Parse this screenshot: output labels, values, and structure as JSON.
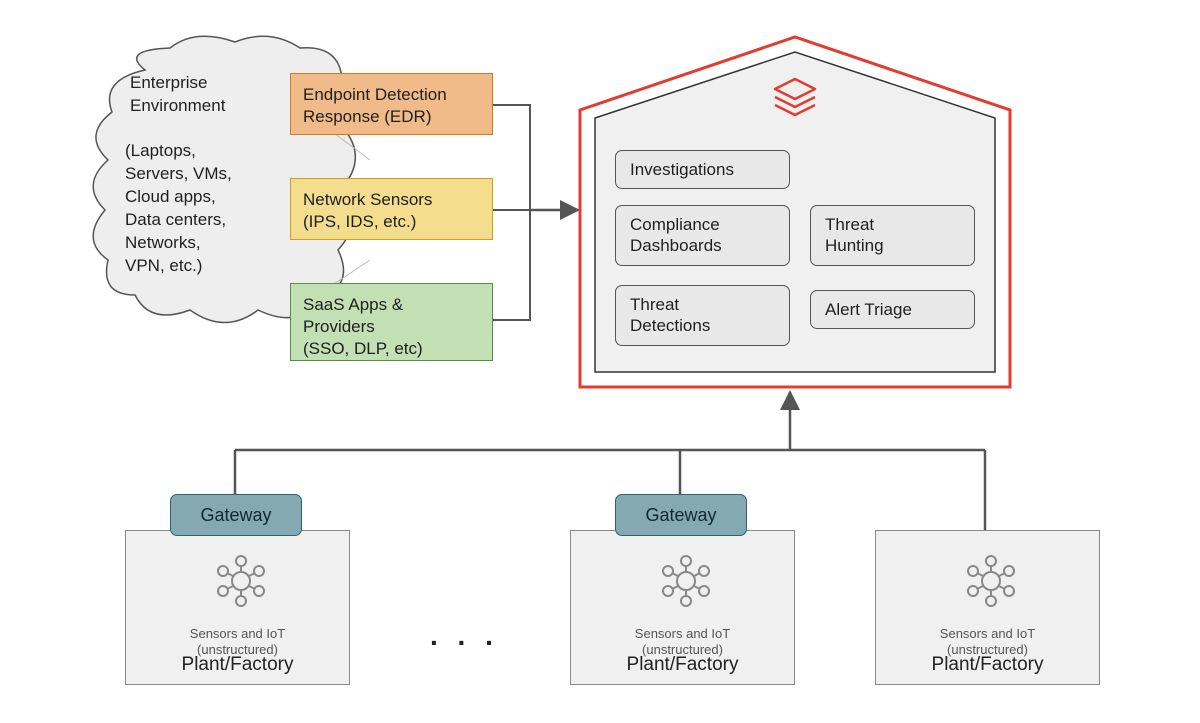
{
  "cloud": {
    "title": "Enterprise\nEnvironment",
    "subtitle": "(Laptops,\nServers, VMs,\nCloud apps,\nData centers,\nNetworks,\nVPN, etc.)"
  },
  "sources": {
    "edr": "Endpoint Detection\nResponse (EDR)",
    "net": "Network Sensors\n(IPS, IDS, etc.)",
    "saas": "SaaS Apps &\nProviders\n(SSO, DLP, etc)"
  },
  "lakehouse": {
    "investigations": "Investigations",
    "compliance": "Compliance\nDashboards",
    "hunting": "Threat\nHunting",
    "detections": "Threat\nDetections",
    "triage": "Alert Triage"
  },
  "gateway_label": "Gateway",
  "plant": {
    "sensors_label": "Sensors and IoT\n(unstructured)",
    "title": "Plant/Factory"
  },
  "ellipsis": ". . ."
}
